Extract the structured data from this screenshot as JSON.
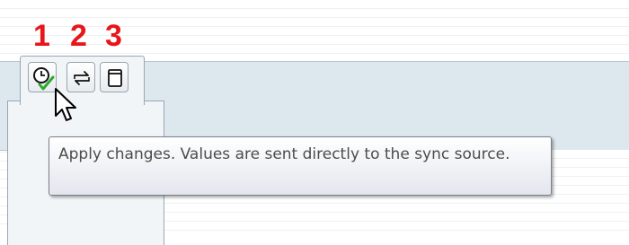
{
  "annotations": {
    "labels": [
      "1",
      "2",
      "3"
    ],
    "color": "#e8161b"
  },
  "toolbar": {
    "buttons": [
      {
        "icon": "clock-check-icon"
      },
      {
        "icon": "sync-arrows-icon"
      },
      {
        "icon": "window-icon"
      }
    ]
  },
  "tooltip": {
    "text": "Apply changes. Values are sent directly to the sync source."
  },
  "colors": {
    "panel": "#f2f5f8",
    "band": "#dde7ee",
    "check": "#2fa82f"
  }
}
